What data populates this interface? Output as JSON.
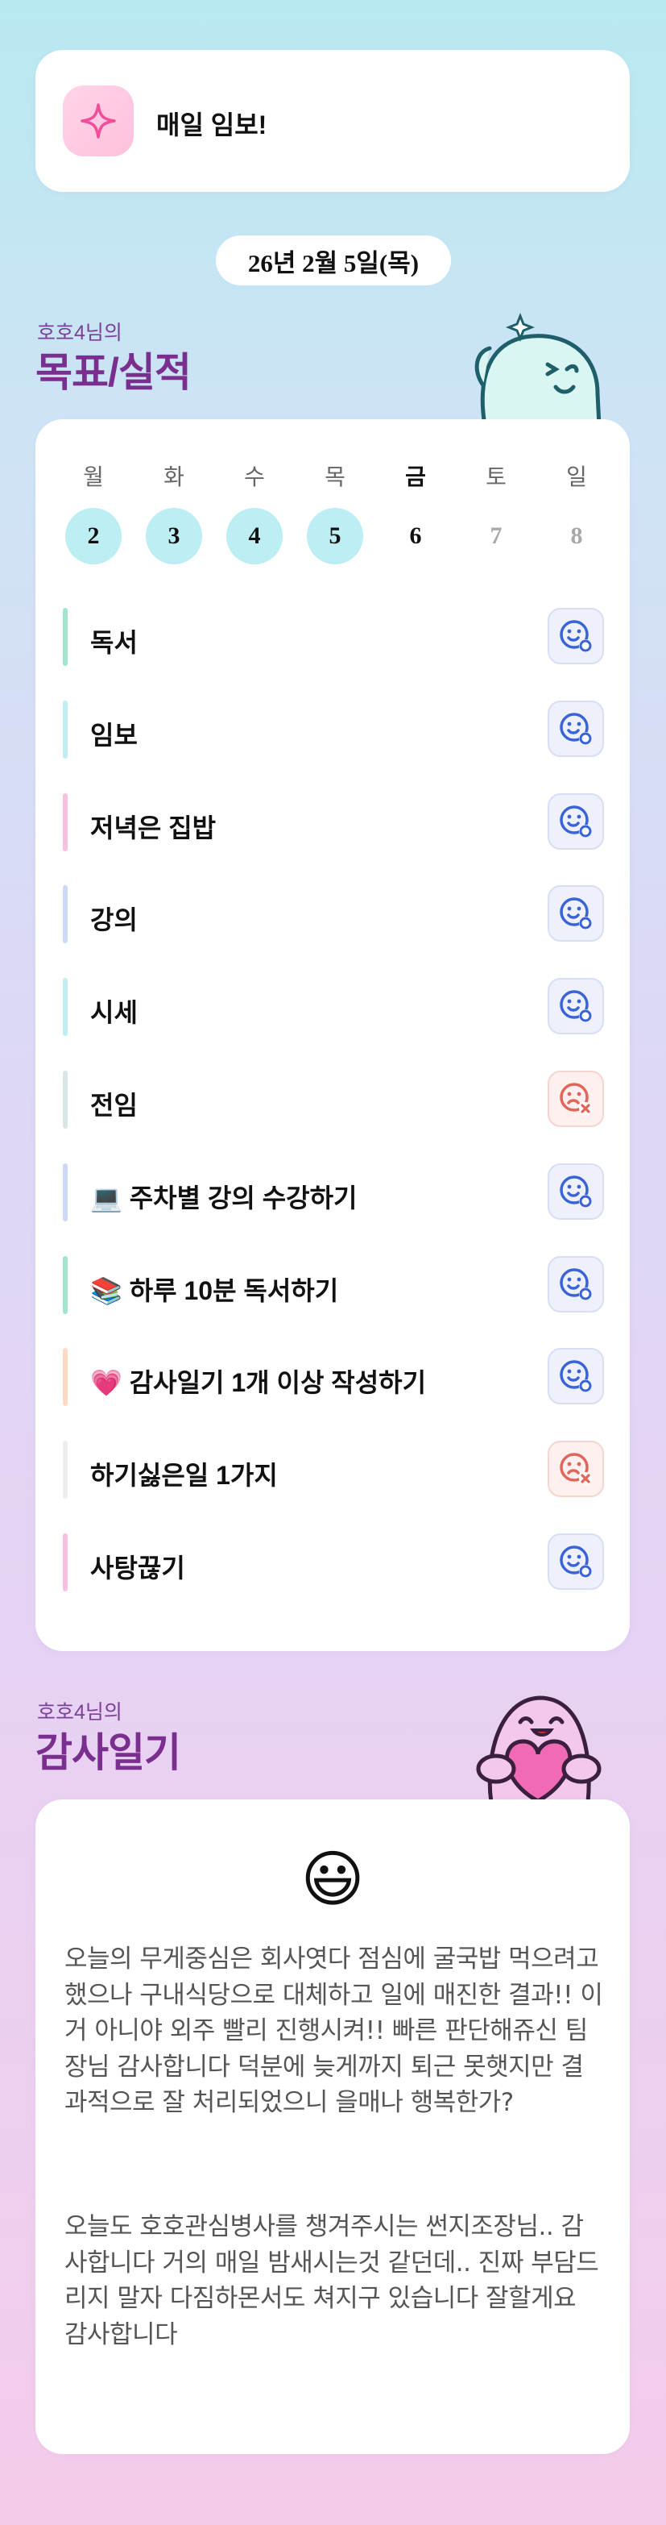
{
  "banner": {
    "title": "매일 임보!",
    "icon": "sparkle-icon"
  },
  "date_pill": "26년 2월 5일(목)",
  "goals_section": {
    "subtitle": "호호4님의",
    "title": "목표/실적"
  },
  "week": [
    {
      "day": "월",
      "num": "2",
      "state": "done"
    },
    {
      "day": "화",
      "num": "3",
      "state": "done"
    },
    {
      "day": "수",
      "num": "4",
      "state": "done"
    },
    {
      "day": "목",
      "num": "5",
      "state": "done"
    },
    {
      "day": "금",
      "num": "6",
      "state": "today"
    },
    {
      "day": "토",
      "num": "7",
      "state": "future"
    },
    {
      "day": "일",
      "num": "8",
      "state": "future"
    }
  ],
  "goals": [
    {
      "label": "독서",
      "bar_color": "#9fe6cf",
      "status": "ok"
    },
    {
      "label": "임보",
      "bar_color": "#bfeef3",
      "status": "ok"
    },
    {
      "label": "저녁은 집밥",
      "bar_color": "#f9bfe0",
      "status": "ok"
    },
    {
      "label": "강의",
      "bar_color": "#cdd9f6",
      "status": "ok"
    },
    {
      "label": "시세",
      "bar_color": "#bfeef3",
      "status": "ok"
    },
    {
      "label": "전임",
      "bar_color": "#d8e6e6",
      "status": "fail"
    },
    {
      "label": "💻 주차별 강의 수강하기",
      "bar_color": "#cdd9f6",
      "status": "ok"
    },
    {
      "label": "📚 하루 10분 독서하기",
      "bar_color": "#9fe6cf",
      "status": "ok"
    },
    {
      "label": "💗 감사일기 1개 이상 작성하기",
      "bar_color": "#ffd9c2",
      "status": "ok"
    },
    {
      "label": "하기싫은일 1가지",
      "bar_color": "#eeeeee",
      "status": "fail"
    },
    {
      "label": "사탕끊기",
      "bar_color": "#f9bfe0",
      "status": "ok"
    }
  ],
  "journal_section": {
    "subtitle": "호호4님의",
    "title": "감사일기"
  },
  "journal": {
    "emoji": "😃",
    "paragraphs": [
      "오늘의 무게중심은 회사엿다 점심에 굴국밥 먹으려고 했으나 구내식당으로 대체하고 일에 매진한 결과!! 이거 아니야 외주 빨리 진행시켜!! 빠른 판단해쥬신 팀장님 감사합니다 덕분에 늦게까지 퇴근 못햇지만 결과적으로 잘 처리되었으니 을매나 행복한가?",
      "오늘도 호호관심병사를 챙겨주시는 썬지조장님.. 감사합니다 거의 매일 밤새시는것 같던데.. 진짜 부담드리지 말자 다짐하몬서도 쳐지구 있습니다 잘할게요 감사합니다"
    ]
  },
  "colors": {
    "accent_purple": "#7a2f8f",
    "done_circle": "#bdeef3",
    "ok_icon": "#3b63d8",
    "fail_icon": "#e0655a"
  }
}
